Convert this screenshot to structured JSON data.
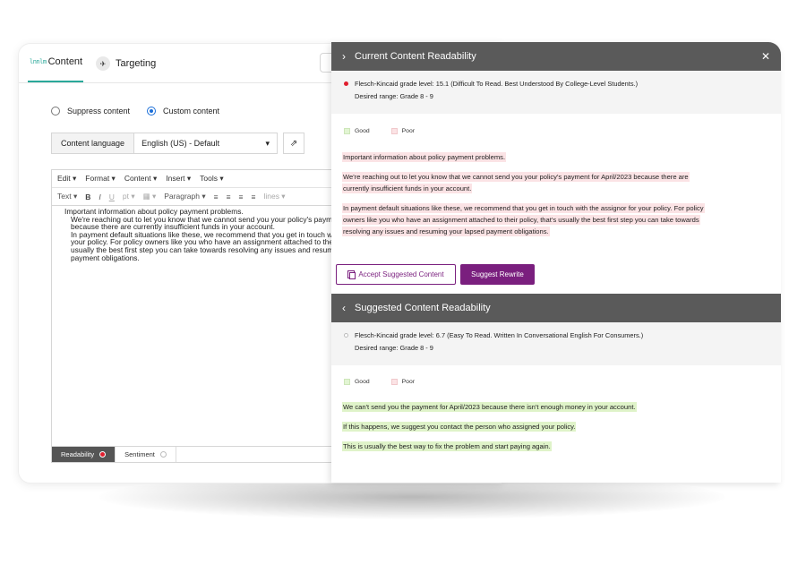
{
  "editor": {
    "tabs": [
      {
        "label": "Content",
        "logo": "lnnlm",
        "icon": "content-logo-icon"
      },
      {
        "label": "Targeting",
        "icon": "target-icon"
      }
    ],
    "radio": {
      "suppress_label": "Suppress content",
      "custom_label": "Custom content",
      "selected": "custom"
    },
    "language": {
      "label": "Content language",
      "value": "English (US) - Default",
      "dropdown_glyph": "▾",
      "external_glyph": "⇗"
    },
    "menubar": [
      "Edit ▾",
      "Format ▾",
      "Content ▾",
      "Insert ▾",
      "Tools ▾"
    ],
    "toolbar": {
      "text": "Text ▾",
      "bold": "B",
      "italic": "I",
      "underline": "U",
      "size": "pt ▾",
      "color": "▦ ▾",
      "paragraph": "Paragraph ▾",
      "align": [
        "≡",
        "≡",
        "≡",
        "≡"
      ],
      "lines": "lines ▾"
    },
    "body_lines": [
      "Important information about policy payment problems.",
      "   We're reaching out to let you know that we cannot send you your policy's payment",
      "   because there are currently insufficient funds in your account.",
      "   In payment default situations like these, we recommend that you get in touch with",
      "   your policy. For policy owners like you who have an assignment attached to their",
      "   usually the best first step you can take towards resolving any issues and resumin",
      "   payment obligations."
    ],
    "status": {
      "readability": "Readability",
      "sentiment": "Sentiment"
    }
  },
  "current_panel": {
    "title": "Current Content Readability",
    "chevron": "›",
    "close": "✕",
    "score": "Flesch-Kincaid grade level: 15.1 (Difficult To Read. Best Understood By College-Level Students.)",
    "desired": "Desired range: Grade 8 - 9",
    "legend_good": "Good",
    "legend_poor": "Poor",
    "paragraphs": [
      "Important information about policy payment problems.",
      "We're reaching out to let you know that we cannot send you your policy's payment for April/2023 because there are",
      "currently insufficient funds in your account.",
      "In payment default situations like these, we recommend that you get in touch with the assignor for your policy. For policy",
      "owners like you who have an assignment attached to their policy, that's usually the best first step you can take towards",
      "resolving any issues and resuming your lapsed payment obligations."
    ],
    "accept_label": "Accept Suggested Content",
    "rewrite_label": "Suggest Rewrite"
  },
  "suggested_panel": {
    "title": "Suggested Content Readability",
    "chevron": "‹",
    "score": "Flesch-Kincaid grade level: 6.7 (Easy To Read. Written In Conversational English For Consumers.)",
    "desired": "Desired range: Grade 8 - 9",
    "legend_good": "Good",
    "legend_poor": "Poor",
    "paragraphs": [
      "We can't send you the payment for April/2023 because there isn't enough money in your account.",
      "If this happens, we suggest you contact the person who assigned your policy.",
      "This is usually the best way to fix the problem and start paying again."
    ]
  },
  "colors": {
    "accent_purple": "#7a1f7e",
    "header_grey": "#5a5a5a",
    "teal": "#2aa89a",
    "poor_highlight": "#fbe3e5",
    "good_highlight": "#dff3c9",
    "alert_red": "#e01e2e"
  }
}
